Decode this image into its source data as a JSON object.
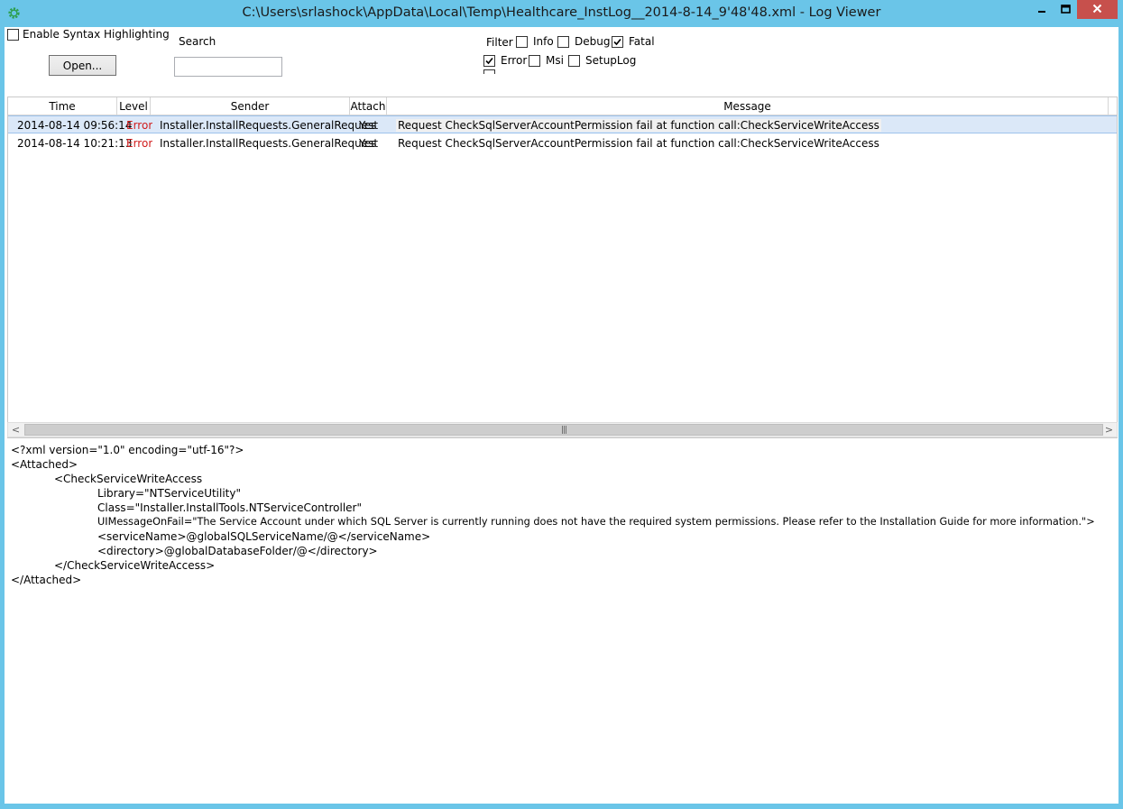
{
  "window": {
    "title": "C:\\Users\\srlashock\\AppData\\Local\\Temp\\Healthcare_InstLog__2014-8-14_9'48'48.xml - Log Viewer"
  },
  "toolbar": {
    "syntax_label": "Enable Syntax Highlighting",
    "syntax_checked": false,
    "open_label": "Open...",
    "search_label": "Search",
    "search_value": "",
    "filter_label": "Filter",
    "filters": [
      {
        "label": "Info",
        "checked": false
      },
      {
        "label": "Debug",
        "checked": false
      },
      {
        "label": "Fatal",
        "checked": true
      },
      {
        "label": "Error",
        "checked": true
      },
      {
        "label": "Msi",
        "checked": false
      },
      {
        "label": "SetupLog",
        "checked": false
      }
    ]
  },
  "grid": {
    "columns": [
      "Time",
      "Level",
      "Sender",
      "Attach",
      "Message"
    ],
    "rows": [
      {
        "time": "2014-08-14 09:56:14",
        "level": "Error",
        "sender": "Installer.InstallRequests.GeneralRequest",
        "attach": "Yes",
        "message": "Request CheckSqlServerAccountPermission fail at function call:CheckServiceWriteAccess",
        "selected": true
      },
      {
        "time": "2014-08-14 10:21:13",
        "level": "Error",
        "sender": "Installer.InstallRequests.GeneralRequest",
        "attach": "Yes",
        "message": "Request CheckSqlServerAccountPermission fail at function call:CheckServiceWriteAccess",
        "selected": false
      }
    ],
    "level_color": "#d01c1c",
    "selected_row_color": "#dbe8f8"
  },
  "scrollbar": {
    "left_arrow": "<",
    "right_arrow": ">",
    "grip": "|||"
  },
  "detail": {
    "lines": [
      "<?xml version=\"1.0\" encoding=\"utf-16\"?>",
      "<Attached>",
      "<CheckServiceWriteAccess",
      "Library=\"NTServiceUtility\"",
      "Class=\"Installer.InstallTools.NTServiceController\"",
      "UIMessageOnFail=\"The Service Account under which SQL Server is currently running does not have the required system permissions. Please refer to the Installation Guide for more information.\">",
      "<serviceName>@globalSQLServiceName/@</serviceName>",
      "<directory>@globalDatabaseFolder/@</directory>",
      "</CheckServiceWriteAccess>",
      "</Attached>"
    ]
  },
  "colors": {
    "title_bar": "#6ac5e8",
    "close_button": "#c7504c"
  },
  "icons": {
    "app": "gear-icon",
    "minimize": "minimize-icon",
    "maximize": "maximize-icon",
    "close": "close-icon",
    "check": "checkmark-icon"
  }
}
